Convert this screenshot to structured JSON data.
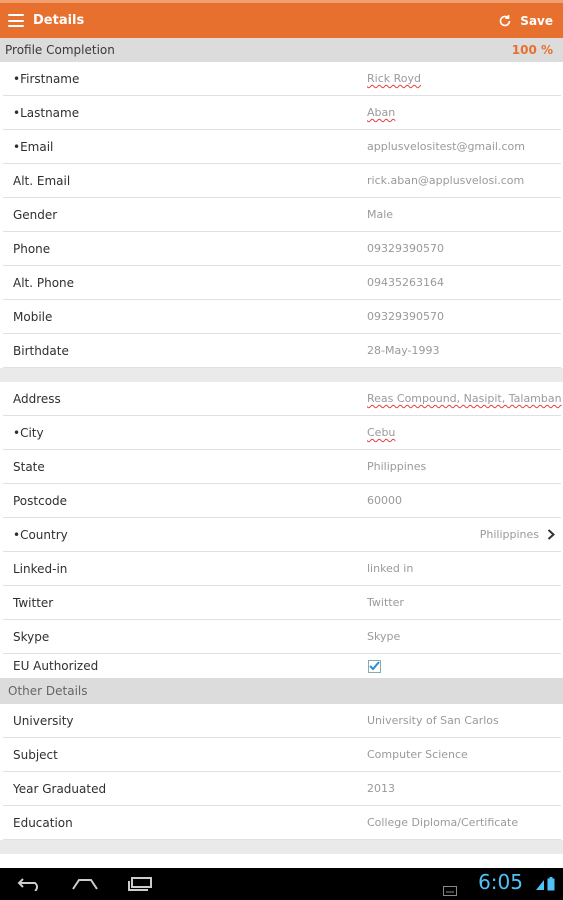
{
  "app": {
    "title": "Details",
    "save_label": "Save",
    "accent": "#e8702e"
  },
  "profile": {
    "label": "Profile Completion",
    "percent": "100 %"
  },
  "fields": [
    {
      "label": "•Firstname",
      "value": "Rick Royd",
      "spell": true
    },
    {
      "label": "•Lastname",
      "value": "Aban",
      "spell": true
    },
    {
      "label": "•Email",
      "value": "applusvelositest@gmail.com"
    },
    {
      "label": "Alt. Email",
      "value": "rick.aban@applusvelosi.com"
    },
    {
      "label": "Gender",
      "value": "Male"
    },
    {
      "label": "Phone",
      "value": "09329390570"
    },
    {
      "label": "Alt. Phone",
      "value": "09435263164"
    },
    {
      "label": "Mobile",
      "value": "09329390570"
    },
    {
      "label": "Birthdate",
      "value": "28-May-1993"
    }
  ],
  "address_fields": [
    {
      "label": "Address",
      "value": "Reas Compound, Nasipit, Talamban",
      "spell": true
    },
    {
      "label": "•City",
      "value": "Cebu",
      "spell": true
    },
    {
      "label": "State",
      "value": "Philippines"
    },
    {
      "label": "Postcode",
      "value": "60000"
    },
    {
      "label": "•Country",
      "value": "Philippines"
    },
    {
      "label": "Linked-in",
      "value": "linked in"
    },
    {
      "label": "Twitter",
      "value": "Twitter"
    },
    {
      "label": "Skype",
      "value": "Skype"
    },
    {
      "label": "EU Authorized",
      "checked": true
    }
  ],
  "other": {
    "header": "Other Details",
    "fields": [
      {
        "label": "University",
        "value": "University of San Carlos"
      },
      {
        "label": "Subject",
        "value": "Computer Science"
      },
      {
        "label": "Year Graduated",
        "value": "2013"
      },
      {
        "label": "Education",
        "value": "College Diploma/Certificate"
      }
    ]
  },
  "status_bar": {
    "time": "6:05"
  }
}
